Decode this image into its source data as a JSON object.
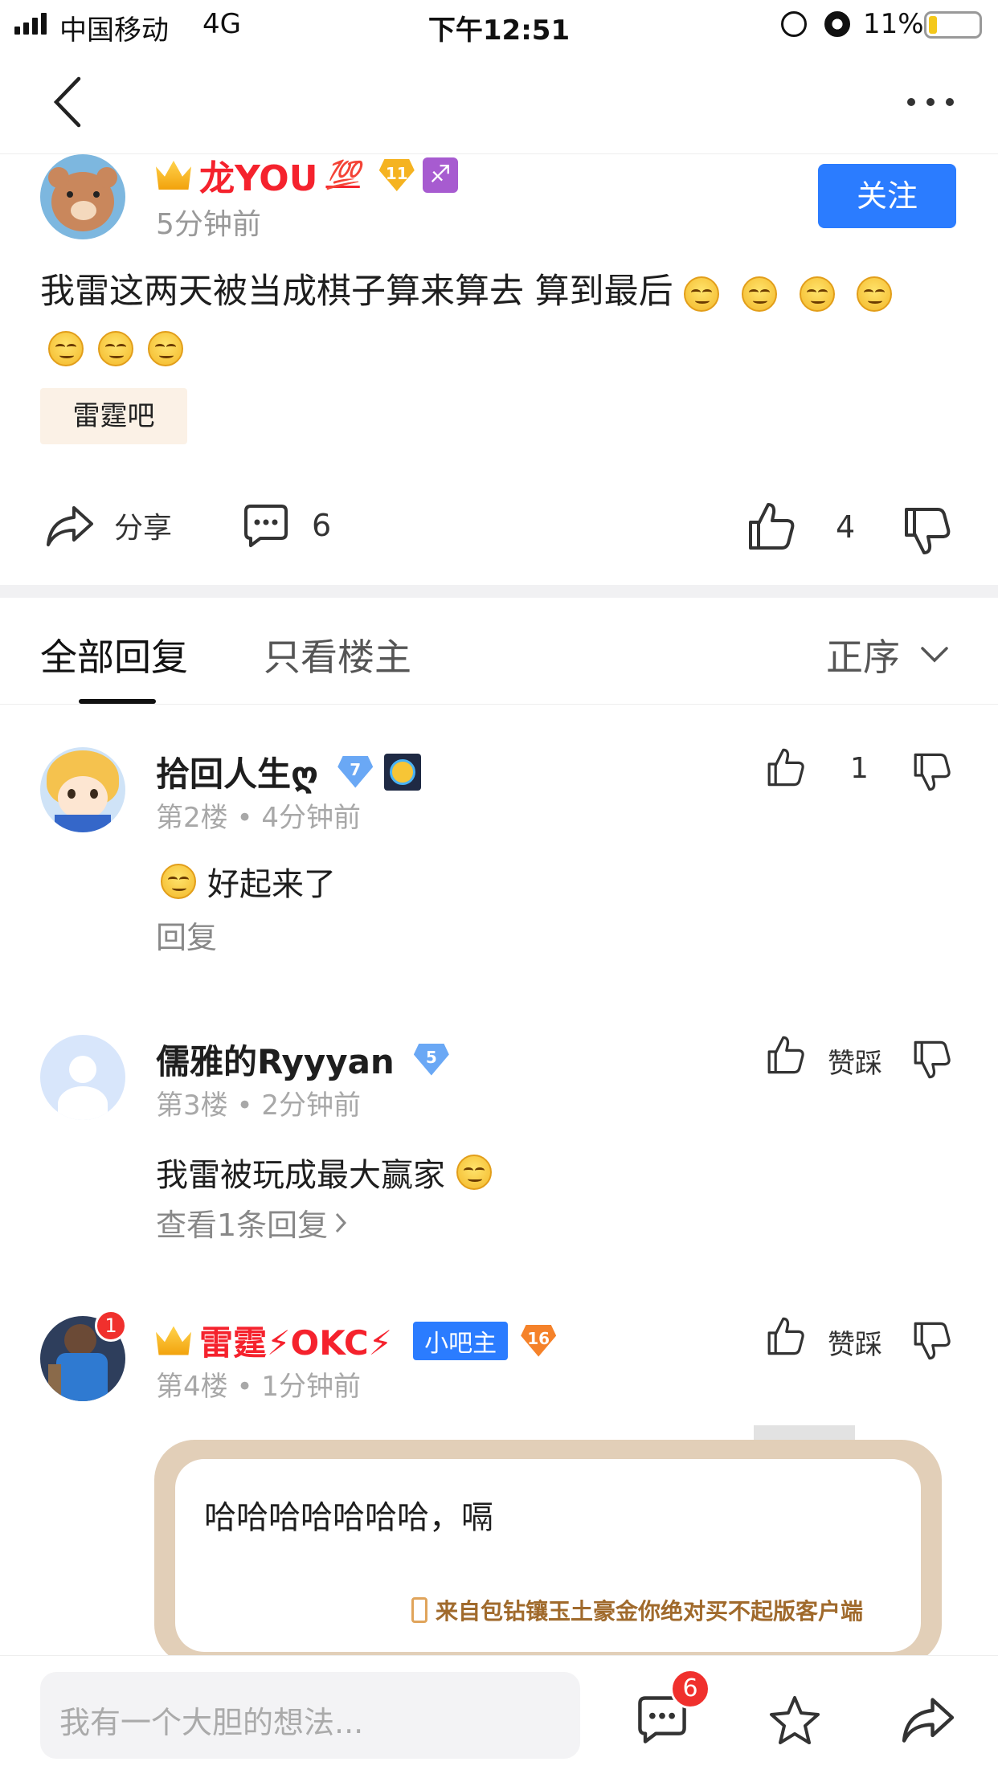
{
  "status": {
    "carrier": "中国移动",
    "network": "4G",
    "time": "下午12:51",
    "battery": "11%"
  },
  "post": {
    "author": "龙YOU",
    "level": "11",
    "time": "5分钟前",
    "follow_label": "关注",
    "content": "我雷这两天被当成棋子算来算去 算到最后",
    "forum_tag": "雷霆吧",
    "share_label": "分享",
    "comment_count": "6",
    "like_count": "4"
  },
  "tabs": {
    "all": "全部回复",
    "owner": "只看楼主",
    "sort": "正序"
  },
  "comments": [
    {
      "name": "拾回人生ღ",
      "level": "7",
      "floor": "第2楼",
      "time": "4分钟前",
      "text": "好起来了",
      "like_count": "1",
      "reply_link": "回复"
    },
    {
      "name": "儒雅的Ryyyan",
      "level": "5",
      "floor": "第3楼",
      "time": "2分钟前",
      "text": "我雷被玩成最大赢家",
      "vote_label": "赞踩",
      "reply_link": "查看1条回复"
    },
    {
      "name": "雷霆⚡OKC⚡",
      "level": "16",
      "floor": "第4楼",
      "time": "1分钟前",
      "role": "小吧主",
      "vote_label": "赞踩",
      "notif": "1",
      "card_text": "哈哈哈哈哈哈哈，嗝",
      "client_text": "来自包钻镶玉土豪金你绝对买不起版客户端"
    }
  ],
  "bottom": {
    "placeholder": "我有一个大胆的想法...",
    "msg_badge": "6"
  },
  "colors": {
    "accent": "#2b7cff",
    "name_red": "#f5222d",
    "tag_bg": "#fbf1e6",
    "card_border": "#e2cfb8"
  }
}
